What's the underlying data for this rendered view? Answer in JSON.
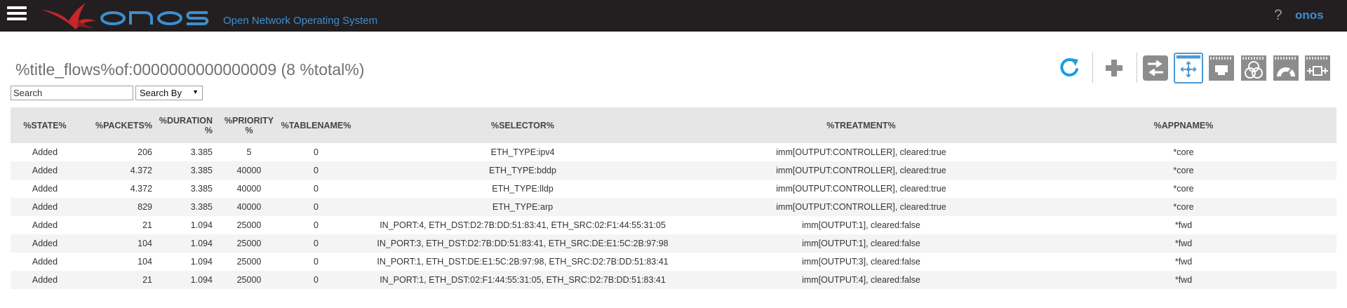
{
  "header": {
    "logo_text": "onos",
    "subtitle": "Open Network Operating System",
    "help_glyph": "?",
    "user": "onos"
  },
  "title": "%title_flows%of:0000000000000009 (8 %total%)",
  "search": {
    "placeholder": "Search",
    "by_label": "Search By",
    "caret": "▼"
  },
  "toolbar": {
    "icons": [
      "refresh-icon",
      "add-icon",
      "devices-view-icon",
      "flows-view-icon",
      "ports-view-icon",
      "groups-view-icon",
      "meters-view-icon",
      "pipeconf-view-icon"
    ],
    "selected": "flows-view-icon",
    "accent": "#4a9ad8",
    "icon_gray": "#8c8c8c"
  },
  "table": {
    "columns": {
      "state": "%STATE%",
      "packets": "%PACKETS%",
      "duration_line1": "%DURATION",
      "duration_line2": "%",
      "priority_line1": "%PRIORITY",
      "priority_line2": "%",
      "tablename": "%TABLENAME%",
      "selector": "%SELECTOR%",
      "treatment": "%TREATMENT%",
      "appname": "%APPNAME%"
    },
    "rows": [
      {
        "state": "Added",
        "packets": "206",
        "duration": "3.385",
        "priority": "5",
        "table": "0",
        "selector": "ETH_TYPE:ipv4",
        "treatment": "imm[OUTPUT:CONTROLLER], cleared:true",
        "app": "*core"
      },
      {
        "state": "Added",
        "packets": "4.372",
        "duration": "3.385",
        "priority": "40000",
        "table": "0",
        "selector": "ETH_TYPE:bddp",
        "treatment": "imm[OUTPUT:CONTROLLER], cleared:true",
        "app": "*core"
      },
      {
        "state": "Added",
        "packets": "4.372",
        "duration": "3.385",
        "priority": "40000",
        "table": "0",
        "selector": "ETH_TYPE:lldp",
        "treatment": "imm[OUTPUT:CONTROLLER], cleared:true",
        "app": "*core"
      },
      {
        "state": "Added",
        "packets": "829",
        "duration": "3.385",
        "priority": "40000",
        "table": "0",
        "selector": "ETH_TYPE:arp",
        "treatment": "imm[OUTPUT:CONTROLLER], cleared:true",
        "app": "*core"
      },
      {
        "state": "Added",
        "packets": "21",
        "duration": "1.094",
        "priority": "25000",
        "table": "0",
        "selector": "IN_PORT:4, ETH_DST:D2:7B:DD:51:83:41, ETH_SRC:02:F1:44:55:31:05",
        "treatment": "imm[OUTPUT:1], cleared:false",
        "app": "*fwd"
      },
      {
        "state": "Added",
        "packets": "104",
        "duration": "1.094",
        "priority": "25000",
        "table": "0",
        "selector": "IN_PORT:3, ETH_DST:D2:7B:DD:51:83:41, ETH_SRC:DE:E1:5C:2B:97:98",
        "treatment": "imm[OUTPUT:1], cleared:false",
        "app": "*fwd"
      },
      {
        "state": "Added",
        "packets": "104",
        "duration": "1.094",
        "priority": "25000",
        "table": "0",
        "selector": "IN_PORT:1, ETH_DST:DE:E1:5C:2B:97:98, ETH_SRC:D2:7B:DD:51:83:41",
        "treatment": "imm[OUTPUT:3], cleared:false",
        "app": "*fwd"
      },
      {
        "state": "Added",
        "packets": "21",
        "duration": "1.094",
        "priority": "25000",
        "table": "0",
        "selector": "IN_PORT:1, ETH_DST:02:F1:44:55:31:05, ETH_SRC:D2:7B:DD:51:83:41",
        "treatment": "imm[OUTPUT:4], cleared:false",
        "app": "*fwd"
      }
    ]
  }
}
